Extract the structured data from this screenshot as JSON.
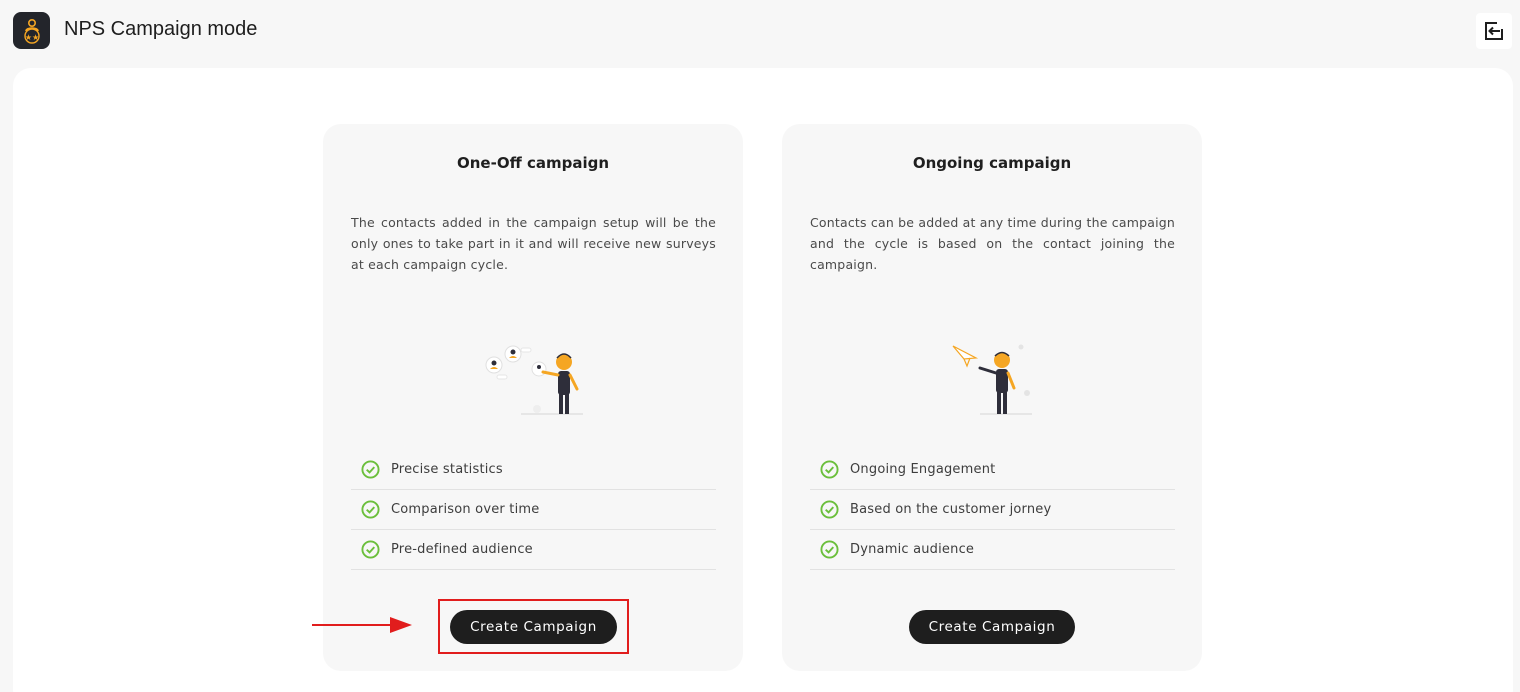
{
  "app": {
    "title": "NPS Campaign mode",
    "logo_icon": "medal-stars-icon",
    "exit_icon": "exit-icon"
  },
  "colors": {
    "accent": "#f5a623",
    "check": "#6bbf3c",
    "button_bg": "#1e1e1e",
    "highlight": "#e11d1d"
  },
  "cards": [
    {
      "title": "One-Off campaign",
      "description": "The contacts added in the campaign setup will be the only ones to take part in it and will receive new surveys at each campaign cycle.",
      "illustration": "person-with-contacts-illustration",
      "features": [
        "Precise statistics",
        "Comparison over time",
        "Pre-defined audience"
      ],
      "button_label": "Create Campaign"
    },
    {
      "title": "Ongoing campaign",
      "description": "Contacts can be added at any time during the campaign and the cycle is based on the contact joining the campaign.",
      "illustration": "person-with-paper-plane-illustration",
      "features": [
        "Ongoing Engagement",
        "Based on the customer jorney",
        "Dynamic audience"
      ],
      "button_label": "Create Campaign"
    }
  ]
}
